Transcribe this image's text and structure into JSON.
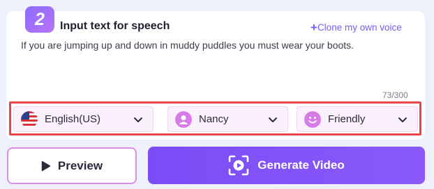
{
  "step": {
    "number": "2",
    "title": "Input text for speech"
  },
  "clone_link": {
    "icon": "plus-icon",
    "label": "Clone my own voice"
  },
  "speech": {
    "text": "If you are jumping up and down in muddy puddles you must wear your boots.",
    "char_count": "73/300"
  },
  "selectors": [
    {
      "icon": "us-flag-icon",
      "value": "English(US)"
    },
    {
      "icon": "person-icon",
      "value": "Nancy"
    },
    {
      "icon": "smiley-icon",
      "value": "Friendly"
    }
  ],
  "buttons": {
    "preview": {
      "icon": "play-icon",
      "label": "Preview"
    },
    "generate": {
      "icon": "video-icon",
      "label": "Generate Video"
    }
  },
  "colors": {
    "accent": "#7b4df7",
    "highlight_border": "#e8474a",
    "select_bg": "#fbf1fd"
  }
}
